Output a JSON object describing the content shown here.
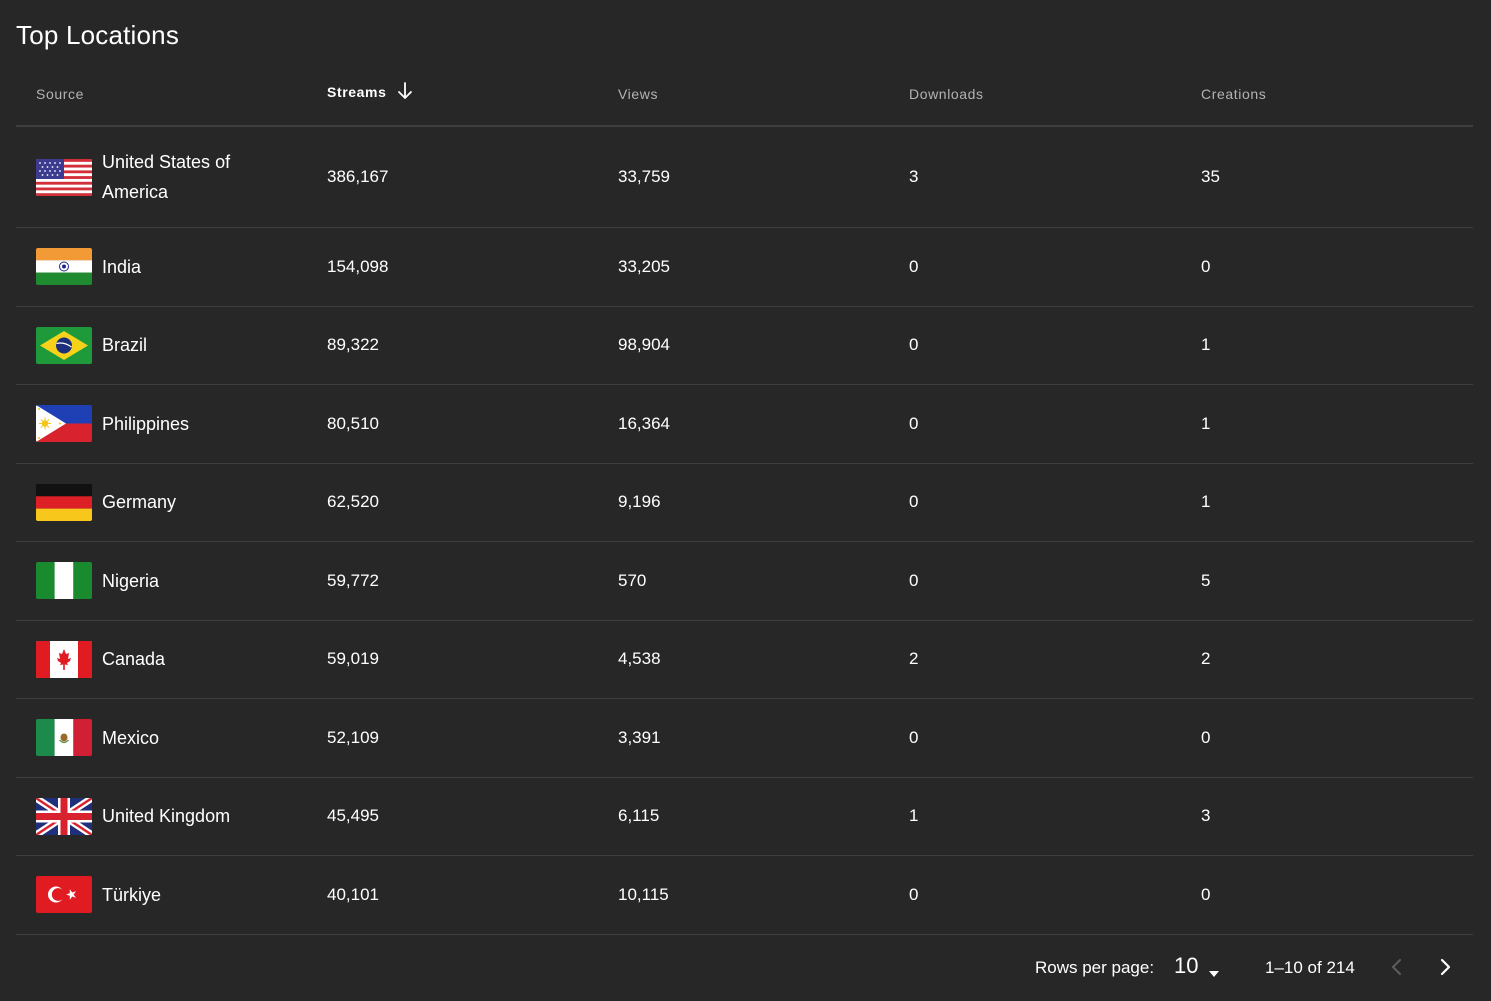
{
  "title": "Top Locations",
  "columns": {
    "source": "Source",
    "streams": "Streams",
    "views": "Views",
    "downloads": "Downloads",
    "creations": "Creations"
  },
  "sort_icon": "arrow-down-icon",
  "rows": [
    {
      "country": "United States of America",
      "flag": "flag-usa-icon",
      "streams": "386,167",
      "views": "33,759",
      "downloads": "3",
      "creations": "35"
    },
    {
      "country": "India",
      "flag": "flag-india-icon",
      "streams": "154,098",
      "views": "33,205",
      "downloads": "0",
      "creations": "0"
    },
    {
      "country": "Brazil",
      "flag": "flag-brazil-icon",
      "streams": "89,322",
      "views": "98,904",
      "downloads": "0",
      "creations": "1"
    },
    {
      "country": "Philippines",
      "flag": "flag-philippines-icon",
      "streams": "80,510",
      "views": "16,364",
      "downloads": "0",
      "creations": "1"
    },
    {
      "country": "Germany",
      "flag": "flag-germany-icon",
      "streams": "62,520",
      "views": "9,196",
      "downloads": "0",
      "creations": "1"
    },
    {
      "country": "Nigeria",
      "flag": "flag-nigeria-icon",
      "streams": "59,772",
      "views": "570",
      "downloads": "0",
      "creations": "5"
    },
    {
      "country": "Canada",
      "flag": "flag-canada-icon",
      "streams": "59,019",
      "views": "4,538",
      "downloads": "2",
      "creations": "2"
    },
    {
      "country": "Mexico",
      "flag": "flag-mexico-icon",
      "streams": "52,109",
      "views": "3,391",
      "downloads": "0",
      "creations": "0"
    },
    {
      "country": "United Kingdom",
      "flag": "flag-uk-icon",
      "streams": "45,495",
      "views": "6,115",
      "downloads": "1",
      "creations": "3"
    },
    {
      "country": "Türkiye",
      "flag": "flag-turkiye-icon",
      "streams": "40,101",
      "views": "10,115",
      "downloads": "0",
      "creations": "0"
    }
  ],
  "pagination": {
    "rows_per_page_label": "Rows per page:",
    "rows_per_page_value": "10",
    "range_label": "1–10 of 214"
  },
  "colors": {
    "background": "#272727",
    "divider": "#3e3e3e",
    "header_text": "#b3b3b3",
    "text": "#ffffff"
  }
}
